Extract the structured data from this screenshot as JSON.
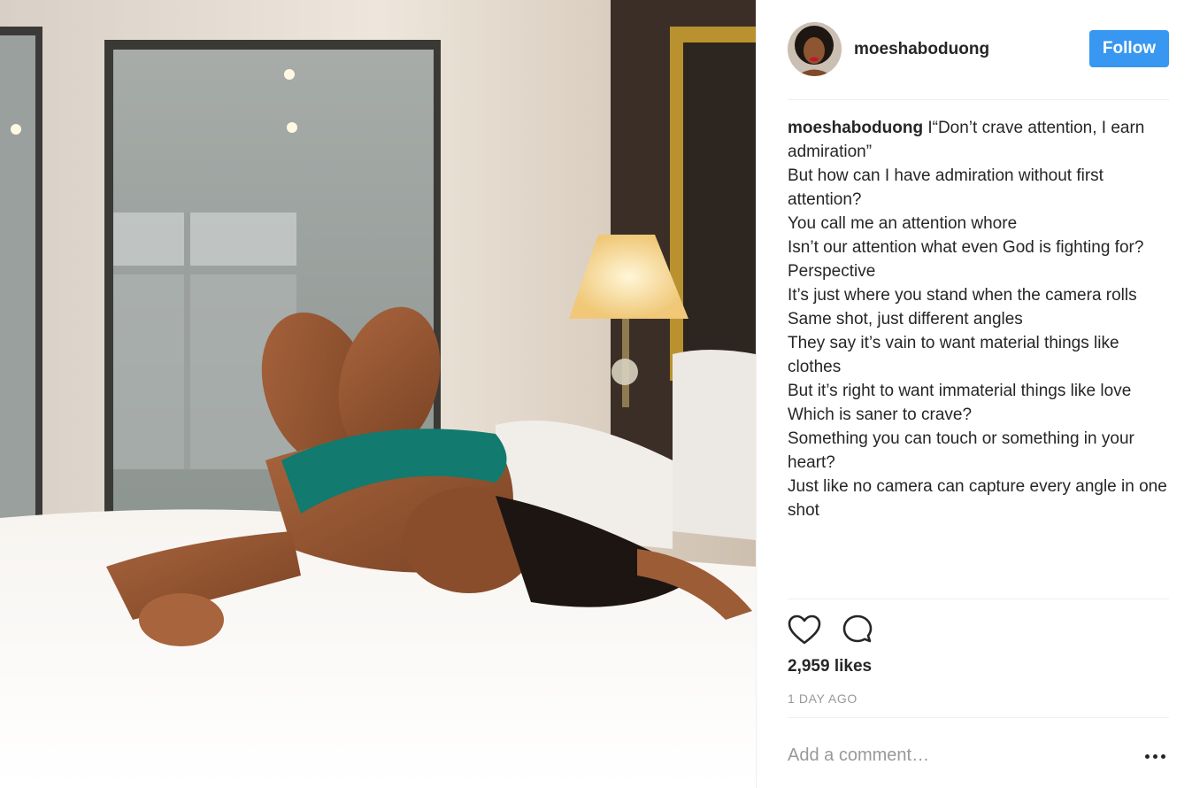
{
  "post": {
    "username": "moeshaboduong",
    "follow_label": "Follow",
    "caption_author": "moeshaboduong",
    "caption_first": " I“Don’t crave attention, I earn admiration”",
    "caption_lines": [
      "But how can I have admiration without first attention?",
      "You call me an attention whore",
      "Isn’t our attention what even God is fighting for?",
      "Perspective",
      "It’s just where you stand when the camera rolls",
      "Same shot, just different angles",
      "They say it’s vain to want material things like clothes",
      "But it’s right to want immaterial things like love",
      "Which is saner to crave?",
      "Something you can touch or something in your heart?",
      "Just like no camera can capture every angle in one shot"
    ],
    "likes": "2,959 likes",
    "time": "1 DAY AGO",
    "comment_placeholder": "Add a comment…"
  },
  "icons": {
    "like": "heart-icon",
    "comment": "comment-bubble-icon",
    "more": "more-options-icon"
  },
  "colors": {
    "follow_button": "#3897f0",
    "text": "#262626",
    "muted": "#999999"
  }
}
